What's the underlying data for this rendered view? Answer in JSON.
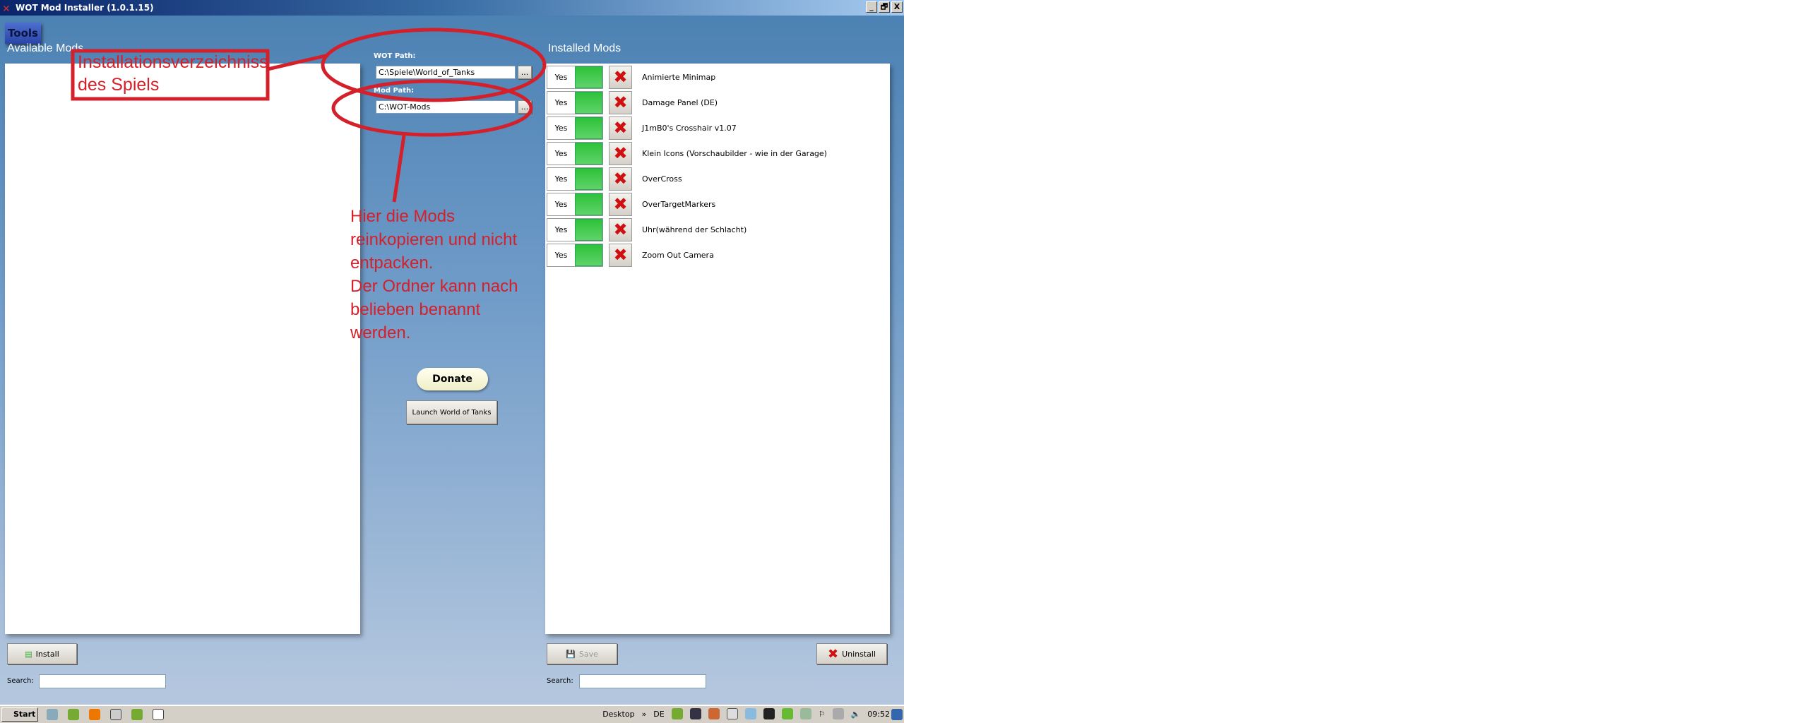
{
  "window": {
    "title": "WOT Mod Installer (1.0.1.15)",
    "controls": [
      "_",
      "🗗",
      "X"
    ]
  },
  "menu": {
    "tools": "Tools"
  },
  "available": {
    "title": "Available Mods",
    "install": "Install",
    "search_label": "Search:",
    "search_value": ""
  },
  "paths": {
    "wot_label": "WOT Path:",
    "wot_value": "C:\\Spiele\\World_of_Tanks",
    "mod_label": "Mod Path:",
    "mod_value": "C:\\WOT-Mods",
    "browse": "..."
  },
  "center": {
    "donate": "Donate",
    "launch": "Launch World of Tanks"
  },
  "installed": {
    "title": "Installed Mods",
    "save": "Save",
    "uninstall": "Uninstall",
    "search_label": "Search:",
    "search_value": "",
    "mods": [
      {
        "enabled": "Yes",
        "name": "Animierte Minimap"
      },
      {
        "enabled": "Yes",
        "name": "Damage Panel (DE)"
      },
      {
        "enabled": "Yes",
        "name": "J1mB0's Crosshair v1.07"
      },
      {
        "enabled": "Yes",
        "name": "Klein Icons (Vorschaubilder - wie in der Garage)"
      },
      {
        "enabled": "Yes",
        "name": "OverCross"
      },
      {
        "enabled": "Yes",
        "name": "OverTargetMarkers"
      },
      {
        "enabled": "Yes",
        "name": "Uhr(während der Schlacht)"
      },
      {
        "enabled": "Yes",
        "name": "Zoom Out Camera"
      }
    ]
  },
  "annotations": {
    "box": [
      "Installationsverzeichniss",
      "des Spiels"
    ],
    "note": [
      "Hier die Mods",
      "reinkopieren und nicht",
      "entpacken.",
      "Der Ordner kann nach",
      "belieben benannt",
      "werden."
    ],
    "color": "#d4202a"
  },
  "taskbar": {
    "start": "Start",
    "desktop": "Desktop",
    "chevron": "»",
    "lang": "DE",
    "clock": "09:52"
  }
}
